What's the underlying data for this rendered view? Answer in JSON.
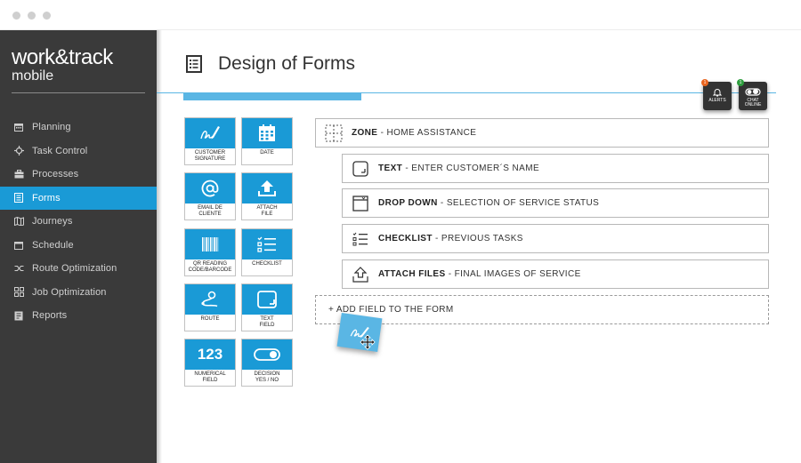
{
  "brand": {
    "name_main": "work&track",
    "name_sub": "mobile"
  },
  "sidebar": {
    "items": [
      {
        "label": "Planning",
        "icon": "calendar-icon",
        "active": false
      },
      {
        "label": "Task Control",
        "icon": "crosshair-icon",
        "active": false
      },
      {
        "label": "Processes",
        "icon": "briefcase-icon",
        "active": false
      },
      {
        "label": "Forms",
        "icon": "form-icon",
        "active": true
      },
      {
        "label": "Journeys",
        "icon": "map-icon",
        "active": false
      },
      {
        "label": "Schedule",
        "icon": "calendar-icon",
        "active": false
      },
      {
        "label": "Route Optimization",
        "icon": "route-icon",
        "active": false
      },
      {
        "label": "Job Optimization",
        "icon": "grid-icon",
        "active": false
      },
      {
        "label": "Reports",
        "icon": "report-icon",
        "active": false
      }
    ]
  },
  "header": {
    "title": "Design of Forms",
    "alerts": {
      "label": "ALERTS",
      "count": "1"
    },
    "chat": {
      "label_line1": "CHAT",
      "label_line2": "ONLINE",
      "count": "1"
    }
  },
  "palette": {
    "items": [
      {
        "label1": "CUSTOMER",
        "label2": "SIGNATURE",
        "icon": "signature-icon"
      },
      {
        "label1": "DATE",
        "label2": "",
        "icon": "calendar-icon"
      },
      {
        "label1": "EMAIL DE",
        "label2": "CLIENTE",
        "icon": "at-icon"
      },
      {
        "label1": "ATTACH",
        "label2": "FILE",
        "icon": "upload-icon"
      },
      {
        "label1": "QR READING",
        "label2": "CODE/BARCODE",
        "icon": "barcode-icon"
      },
      {
        "label1": "CHECKLIST",
        "label2": "",
        "icon": "checklist-icon"
      },
      {
        "label1": "ROUTE",
        "label2": "",
        "icon": "route-icon"
      },
      {
        "label1": "TEXT",
        "label2": "FIELD",
        "icon": "text-field-icon"
      },
      {
        "label1": "NUMERICAL",
        "label2": "FIELD",
        "icon": "numeric-icon",
        "tile_text": "123"
      },
      {
        "label1": "DECISION",
        "label2": "YES / NO",
        "icon": "toggle-icon"
      }
    ]
  },
  "form": {
    "zone": {
      "label": "ZONE",
      "description": " - HOME ASSISTANCE"
    },
    "fields": [
      {
        "label": "TEXT",
        "description": " - ENTER CUSTOMER´S NAME",
        "icon": "text-field-icon"
      },
      {
        "label": "DROP DOWN",
        "description": " - SELECTION OF SERVICE STATUS",
        "icon": "dropdown-icon"
      },
      {
        "label": "CHECKLIST",
        "description": " - PREVIOUS TASKS",
        "icon": "checklist-icon"
      },
      {
        "label": "ATTACH FILES",
        "description": " - FINAL IMAGES OF SERVICE",
        "icon": "attach-icon"
      }
    ],
    "add_label": "+ ADD FIELD TO THE FORM"
  },
  "colors": {
    "accent": "#1a9ad6",
    "accent_light": "#5ab6e4",
    "sidebar": "#3a3a3a",
    "alert_badge": "#e8641e",
    "chat_badge": "#2e9e3e"
  }
}
